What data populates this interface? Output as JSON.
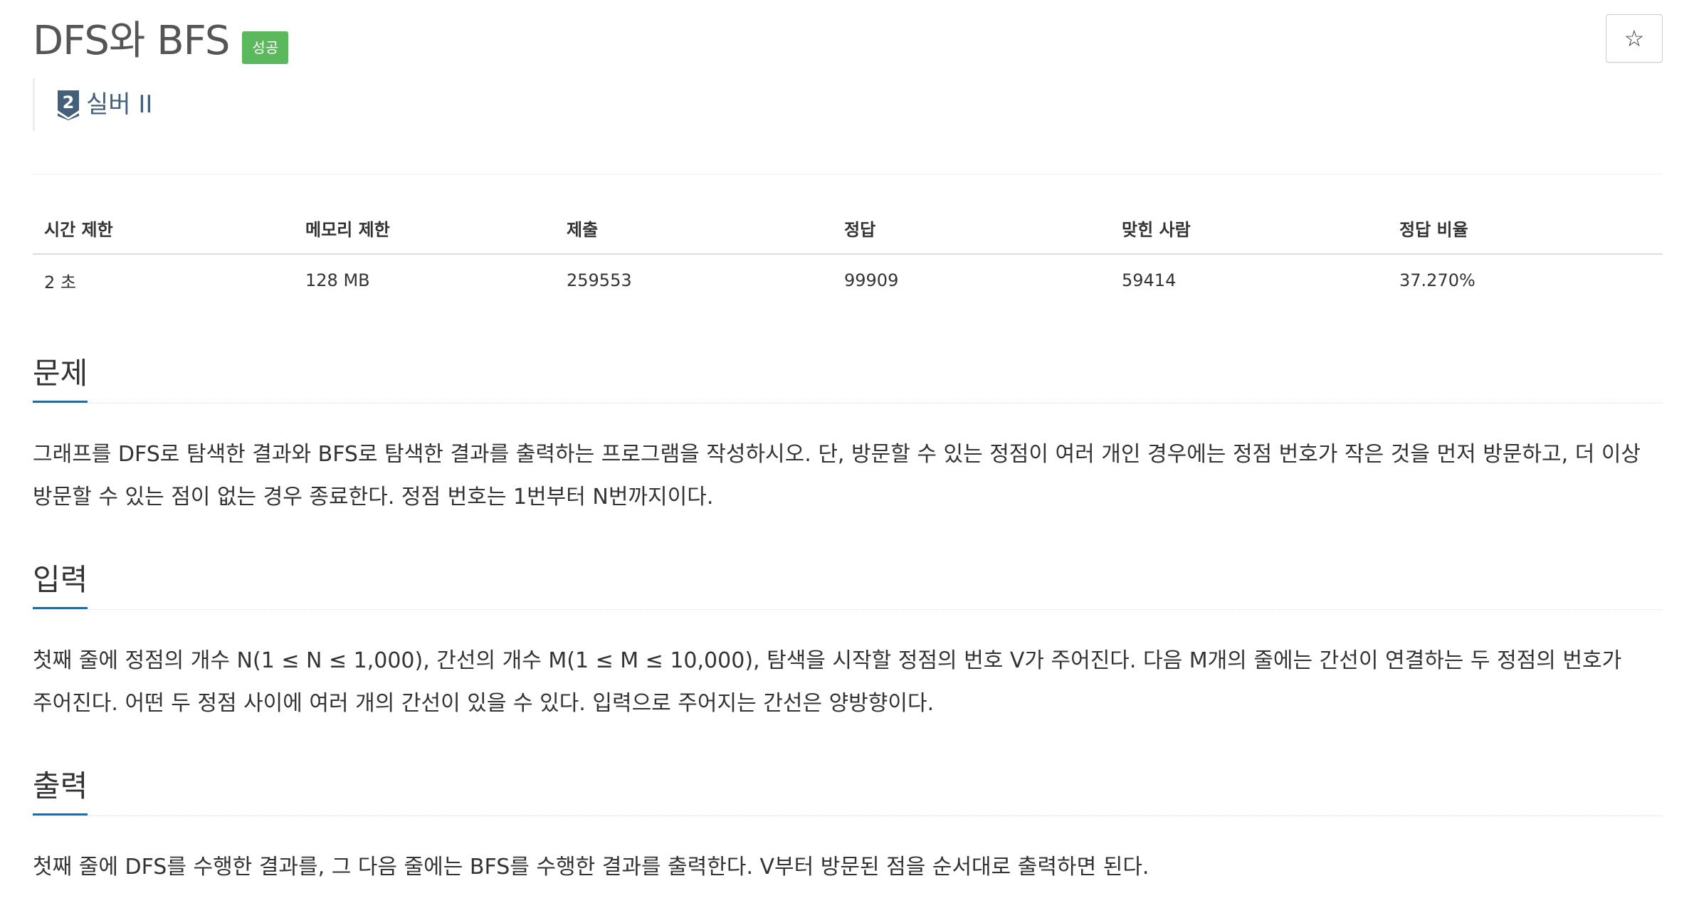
{
  "problem": {
    "title": "DFS와 BFS",
    "badge": "성공",
    "star_icon": "☆",
    "tier_number": "2",
    "tier_label": "실버 II"
  },
  "stats": {
    "headers": [
      "시간 제한",
      "메모리 제한",
      "제출",
      "정답",
      "맞힌 사람",
      "정답 비율"
    ],
    "values": [
      "2 초",
      "128 MB",
      "259553",
      "99909",
      "59414",
      "37.270%"
    ]
  },
  "sections": {
    "description": {
      "title": "문제",
      "text": "그래프를 DFS로 탐색한 결과와 BFS로 탐색한 결과를 출력하는 프로그램을 작성하시오. 단, 방문할 수 있는 정점이 여러 개인 경우에는 정점 번호가 작은 것을 먼저 방문하고, 더 이상 방문할 수 있는 점이 없는 경우 종료한다. 정점 번호는 1번부터 N번까지이다."
    },
    "input": {
      "title": "입력",
      "text": "첫째 줄에 정점의 개수 N(1 ≤ N ≤ 1,000), 간선의 개수 M(1 ≤ M ≤ 10,000), 탐색을 시작할 정점의 번호 V가 주어진다. 다음 M개의 줄에는 간선이 연결하는 두 정점의 번호가 주어진다. 어떤 두 정점 사이에 여러 개의 간선이 있을 수 있다. 입력으로 주어지는 간선은 양방향이다."
    },
    "output": {
      "title": "출력",
      "text": "첫째 줄에 DFS를 수행한 결과를, 그 다음 줄에는 BFS를 수행한 결과를 출력한다. V부터 방문된 점을 순서대로 출력하면 된다."
    }
  },
  "colors": {
    "badge_success": "#5cb85c",
    "tier_silver": "#435f7a",
    "section_underline": "#0076c0"
  }
}
